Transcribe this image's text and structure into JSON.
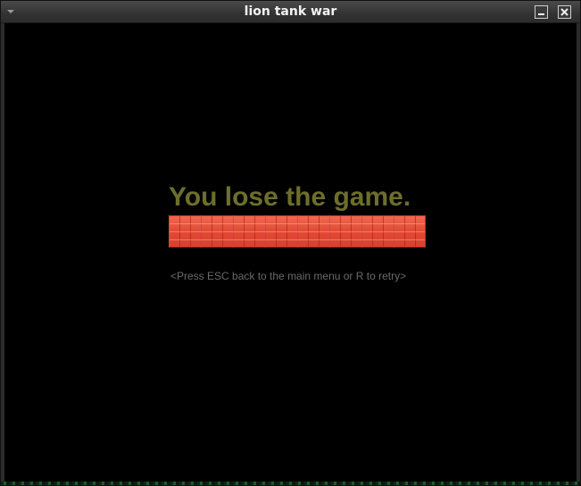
{
  "window": {
    "title": "lion tank war",
    "minimize_icon": "minimize-icon",
    "close_icon": "close-icon"
  },
  "game": {
    "message": "You lose the game.",
    "hint": "<Press ESC back to the main menu or R to retry>",
    "message_color": "#6e6e2c",
    "bar_color": "#e8503a",
    "background_color": "#000000"
  }
}
